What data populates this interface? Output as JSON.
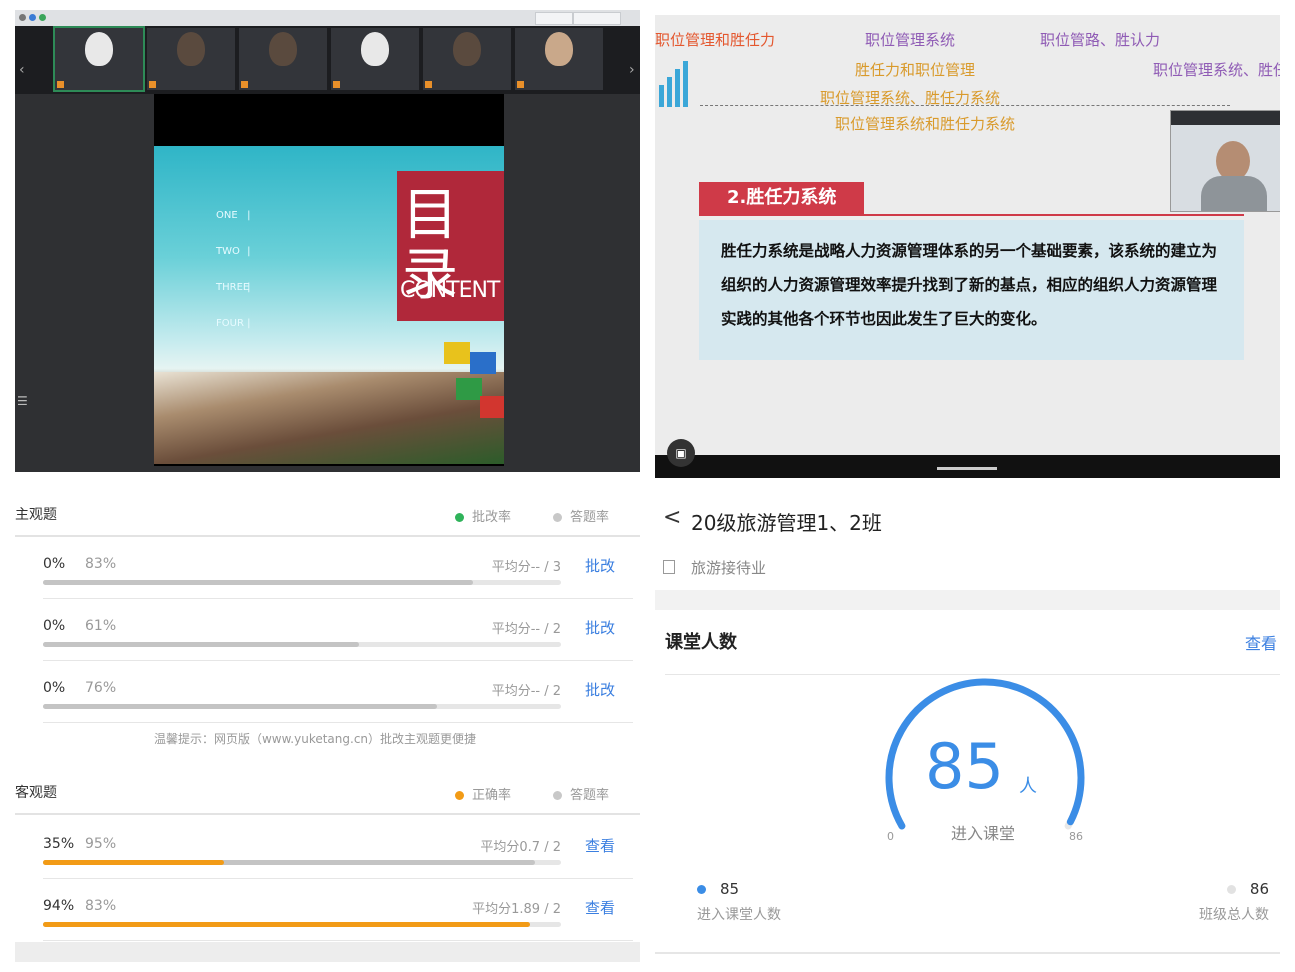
{
  "meeting": {
    "toolbar_items": [
      "",
      ""
    ],
    "participants": [
      {
        "name": "",
        "active": true,
        "face": "white"
      },
      {
        "name": "",
        "active": false,
        "face": "dark"
      },
      {
        "name": "",
        "active": false,
        "face": "dark"
      },
      {
        "name": "",
        "active": false,
        "face": "white"
      },
      {
        "name": "",
        "active": false,
        "face": "dark"
      },
      {
        "name": "",
        "active": false,
        "face": "skin"
      }
    ],
    "stage_label": "",
    "slide": {
      "title": "目录",
      "subtitle": "CONTENT",
      "menu": [
        {
          "num": "ONE",
          "text": ""
        },
        {
          "num": "TWO",
          "text": ""
        },
        {
          "num": "THREE",
          "text": ""
        },
        {
          "num": "FOUR",
          "text": ""
        }
      ]
    }
  },
  "lecture": {
    "headings": [
      {
        "text": "职位管理和胜任力",
        "color": "#e4572e"
      },
      {
        "text": "职位管理系统",
        "color": "#8f5bb5"
      },
      {
        "text": "职位管路、胜认力",
        "color": "#8f5bb5"
      },
      {
        "text": "胜任力和职位管理",
        "color": "#d99a2b"
      },
      {
        "text": "职位管理系统、胜任力系统",
        "color": "#8f5bb5"
      },
      {
        "text": "职位管理系统、胜任力系统",
        "color": "#d99a2b"
      },
      {
        "text": "职位管理系统和胜任力系统",
        "color": "#d99a2b"
      }
    ],
    "section_title": "2.胜任力系统",
    "body": "胜任力系统是战略人力资源管理体系的另一个基础要素，该系统的建立为组织的人力资源管理效率提升找到了新的基点，相应的组织人力资源管理实践的其他各个环节也因此发生了巨大的变化。",
    "presenter_name": ""
  },
  "grading": {
    "subjective": {
      "title": "主观题",
      "legend": [
        "批改率",
        "答题率"
      ],
      "legend_colors": [
        "#2fb35a",
        "#c8c8c8"
      ],
      "rows": [
        {
          "rate_a": "0%",
          "rate_b": "83%",
          "answer_fraction": 0.83,
          "avg": "平均分-- / 3",
          "action": "批改"
        },
        {
          "rate_a": "0%",
          "rate_b": "61%",
          "answer_fraction": 0.61,
          "avg": "平均分-- / 2",
          "action": "批改"
        },
        {
          "rate_a": "0%",
          "rate_b": "76%",
          "answer_fraction": 0.76,
          "avg": "平均分-- / 2",
          "action": "批改"
        }
      ]
    },
    "tip": "温馨提示：网页版（www.yuketang.cn）批改主观题更便捷",
    "objective": {
      "title": "客观题",
      "legend": [
        "正确率",
        "答题率"
      ],
      "legend_colors": [
        "#f29b16",
        "#c8c8c8"
      ],
      "rows": [
        {
          "rate_a": "35%",
          "rate_b": "95%",
          "correct_fraction": 0.35,
          "answer_fraction": 0.95,
          "avg": "平均分0.7 / 2",
          "action": "查看"
        },
        {
          "rate_a": "94%",
          "rate_b": "83%",
          "correct_fraction": 0.94,
          "answer_fraction": 0.83,
          "avg": "平均分1.89 / 2",
          "action": "查看"
        }
      ]
    }
  },
  "class": {
    "back": "<",
    "title": "20级旅游管理1、2班",
    "course": "旅游接待业",
    "card_title": "课堂人数",
    "card_link": "查看",
    "gauge": {
      "value": "85",
      "unit": "人",
      "label": "进入课堂",
      "min": "0",
      "max": "86",
      "fraction": 0.988
    },
    "stats": [
      {
        "value": "85",
        "label": "进入课堂人数",
        "color": "#3b8de6"
      },
      {
        "value": "86",
        "label": "班级总人数",
        "color": "#e2e2e2"
      }
    ]
  }
}
